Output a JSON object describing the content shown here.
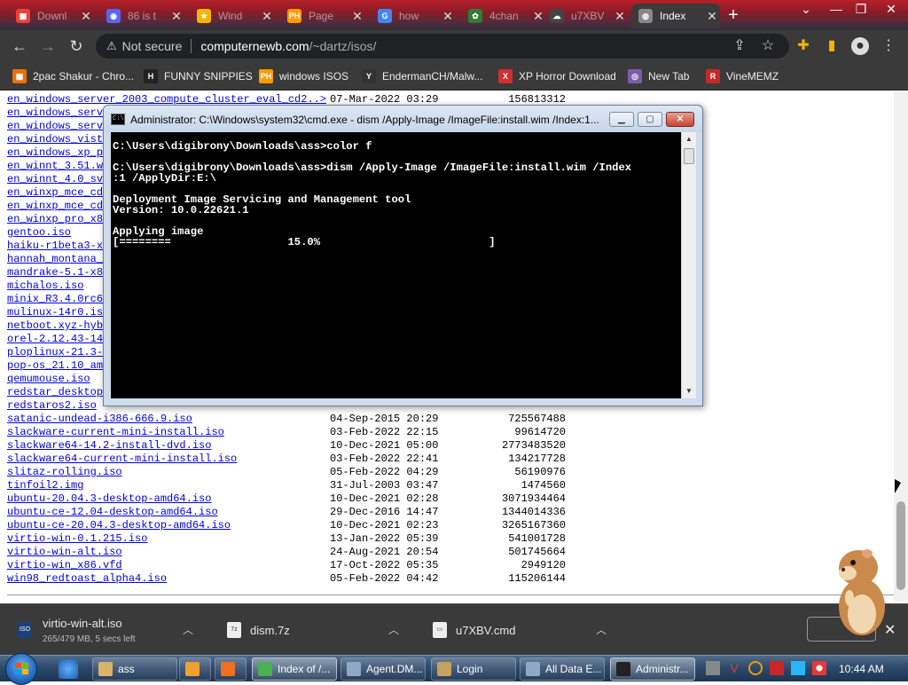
{
  "browser": {
    "tabs": [
      {
        "title": "Downl",
        "color": "#ea4335",
        "glyph": "▦"
      },
      {
        "title": "86 is t",
        "color": "#5865f2",
        "glyph": "◉"
      },
      {
        "title": "Wind",
        "color": "#f4b400",
        "glyph": "★"
      },
      {
        "title": "Page",
        "color": "#ff9900",
        "glyph": "PH"
      },
      {
        "title": "how",
        "color": "#4285f4",
        "glyph": "G"
      },
      {
        "title": "4chan",
        "color": "#2e7d32",
        "glyph": "✿"
      },
      {
        "title": "u7XBV",
        "color": "#444444",
        "glyph": "☁"
      },
      {
        "title": "Index",
        "color": "#888888",
        "glyph": "◍"
      }
    ],
    "not_secure": "Not secure",
    "url_host": "computernewb.com",
    "url_path": "/~dartz/isos/",
    "bookmarks": [
      {
        "label": "2pac Shakur - Chro...",
        "color": "#e8710a",
        "glyph": "▩"
      },
      {
        "label": "FUNNY SNIPPIES",
        "color": "#222222",
        "glyph": "H"
      },
      {
        "label": "windows ISOS",
        "color": "#ff9900",
        "glyph": "PH"
      },
      {
        "label": "EndermanCH/Malw...",
        "color": "#333333",
        "glyph": "Y"
      },
      {
        "label": "XP Horror Download",
        "color": "#d32f2f",
        "glyph": "X"
      },
      {
        "label": "New Tab",
        "color": "#7b5ea7",
        "glyph": "◎"
      },
      {
        "label": "VineMEMZ",
        "color": "#c62828",
        "glyph": "R"
      }
    ]
  },
  "listing": [
    {
      "name": "en_windows_server_2003_compute_cluster_eval_cd2..>",
      "date": "07-Mar-2022 03:29",
      "size": "156813312"
    },
    {
      "name": "en_windows_serv",
      "date": "",
      "size": ""
    },
    {
      "name": "en_windows_serv",
      "date": "",
      "size": ""
    },
    {
      "name": "en_windows_vist",
      "date": "",
      "size": ""
    },
    {
      "name": "en_windows_xp_p",
      "date": "",
      "size": ""
    },
    {
      "name": "en_winnt_3.51.w",
      "date": "",
      "size": ""
    },
    {
      "name": "en_winnt_4.0_sv",
      "date": "",
      "size": ""
    },
    {
      "name": "en_winxp_mce_cd",
      "date": "",
      "size": ""
    },
    {
      "name": "en_winxp_mce_cd",
      "date": "",
      "size": ""
    },
    {
      "name": "en_winxp_pro_x8",
      "date": "",
      "size": ""
    },
    {
      "name": "gentoo.iso",
      "date": "",
      "size": ""
    },
    {
      "name": "haiku-r1beta3-x",
      "date": "",
      "size": ""
    },
    {
      "name": "hannah_montana_",
      "date": "",
      "size": ""
    },
    {
      "name": "mandrake-5.1-x8",
      "date": "",
      "size": ""
    },
    {
      "name": "michalos.iso",
      "date": "",
      "size": ""
    },
    {
      "name": "minix_R3.4.0rc6",
      "date": "",
      "size": ""
    },
    {
      "name": "mulinux-14r0.is",
      "date": "",
      "size": ""
    },
    {
      "name": "netboot.xyz-hyb",
      "date": "",
      "size": ""
    },
    {
      "name": "orel-2.12.43-14",
      "date": "",
      "size": ""
    },
    {
      "name": "ploplinux-21.3-",
      "date": "",
      "size": ""
    },
    {
      "name": "pop-os_21.10_am",
      "date": "",
      "size": ""
    },
    {
      "name": "qemumouse.iso",
      "date": "",
      "size": ""
    },
    {
      "name": "redstar_desktop",
      "date": "",
      "size": ""
    },
    {
      "name": "redstaros2.iso",
      "date": "",
      "size": ""
    },
    {
      "name": "satanic-undead-i386-666.9.iso",
      "date": "04-Sep-2015 20:29",
      "size": "725567488"
    },
    {
      "name": "slackware-current-mini-install.iso",
      "date": "03-Feb-2022 22:15",
      "size": "99614720"
    },
    {
      "name": "slackware64-14.2-install-dvd.iso",
      "date": "10-Dec-2021 05:00",
      "size": "2773483520"
    },
    {
      "name": "slackware64-current-mini-install.iso",
      "date": "03-Feb-2022 22:41",
      "size": "134217728"
    },
    {
      "name": "slitaz-rolling.iso",
      "date": "05-Feb-2022 04:29",
      "size": "56190976"
    },
    {
      "name": "tinfoil2.img",
      "date": "31-Jul-2003 03:47",
      "size": "1474560"
    },
    {
      "name": "ubuntu-20.04.3-desktop-amd64.iso",
      "date": "10-Dec-2021 02:28",
      "size": "3071934464"
    },
    {
      "name": "ubuntu-ce-12.04-desktop-amd64.iso",
      "date": "29-Dec-2016 14:47",
      "size": "1344014336"
    },
    {
      "name": "ubuntu-ce-20.04.3-desktop-amd64.iso",
      "date": "10-Dec-2021 02:23",
      "size": "3265167360"
    },
    {
      "name": "virtio-win-0.1.215.iso",
      "date": "13-Jan-2022 05:39",
      "size": "541001728"
    },
    {
      "name": "virtio-win-alt.iso",
      "date": "24-Aug-2021 20:54",
      "size": "501745664"
    },
    {
      "name": "virtio-win_x86.vfd",
      "date": "17-Oct-2022 05:35",
      "size": "2949120"
    },
    {
      "name": "win98_redtoast_alpha4.iso",
      "date": "05-Feb-2022 04:42",
      "size": "115206144"
    }
  ],
  "cmd": {
    "title": "Administrator: C:\\Windows\\system32\\cmd.exe - dism  /Apply-Image /ImageFile:install.wim /Index:1...",
    "lines": [
      "C:\\Users\\digibrony\\Downloads\\ass>color f",
      "",
      "C:\\Users\\digibrony\\Downloads\\ass>dism /Apply-Image /ImageFile:install.wim /Index",
      ":1 /ApplyDir:E:\\",
      "",
      "Deployment Image Servicing and Management tool",
      "Version: 10.0.22621.1",
      "",
      "Applying image",
      "[========                  15.0%                          ]"
    ]
  },
  "downloads": [
    {
      "name": "virtio-win-alt.iso",
      "sub": "265/479 MB, 5 secs left",
      "icon": "ISO"
    },
    {
      "name": "dism.7z",
      "sub": "",
      "icon": "7z"
    },
    {
      "name": "u7XBV.cmd",
      "sub": "",
      "icon": "▭"
    }
  ],
  "taskbar": {
    "items": [
      {
        "label": "ass",
        "color": "#d9b36a"
      },
      {
        "label": "",
        "color": "#f0a030"
      },
      {
        "label": "",
        "color": "#f07020"
      },
      {
        "label": "Index of /...",
        "color": "#4caf50",
        "active": true
      },
      {
        "label": "Agent.DM...",
        "color": "#8fa8c8"
      },
      {
        "label": "Login",
        "color": "#c8a060"
      },
      {
        "label": "All Data E...",
        "color": "#8fa8c8"
      },
      {
        "label": "Administr...",
        "color": "#222222",
        "active": true
      }
    ],
    "clock": "10:44 AM"
  }
}
